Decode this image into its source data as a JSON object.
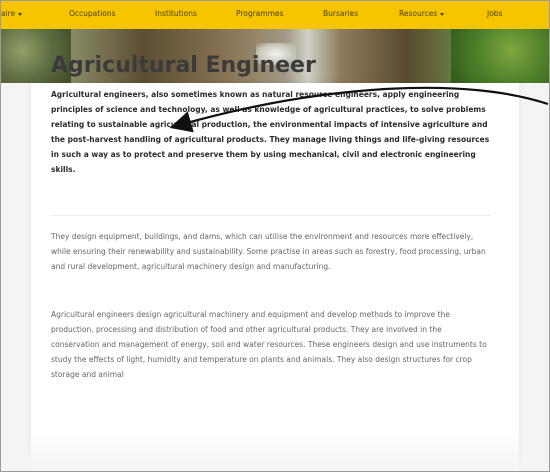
{
  "nav": {
    "items": [
      {
        "label": "aire",
        "dropdown": true
      },
      {
        "label": "Occupations",
        "dropdown": false
      },
      {
        "label": "Institutions",
        "dropdown": false
      },
      {
        "label": "Programmes",
        "dropdown": false
      },
      {
        "label": "Bursaries",
        "dropdown": false
      },
      {
        "label": "Resources",
        "dropdown": true
      },
      {
        "label": "Jobs",
        "dropdown": false
      }
    ],
    "bar_color": "#f6c500"
  },
  "hero": {
    "image": "waterfall-landscape-banner"
  },
  "page": {
    "title": "Agricultural Engineer",
    "lead": "Agricultural engineers, also sometimes known as natural resource engineers, apply engineering principles of science and technology, as well as knowledge of agricultural practices, to solve problems relating to sustainable agricultural production, the environmental impacts of intensive agriculture and the post-harvest handling of agricultural products. They manage living things and life-giving resources in such a way as to protect and preserve them by using mechanical, civil and electronic engineering skills.",
    "paragraphs": [
      "They design equipment, buildings, and dams, which can utilise the environment and resources more effectively, while ensuring their renewability and sustainability. Some practise in areas such as forestry, food processing, urban and rural development, agricultural machinery design and manufacturing.",
      "Agricultural engineers design agricultural machinery and equipment and develop methods to improve the production, processing and distribution of food and other agricultural products. They are involved in the conservation and management of energy, soil and water resources. These engineers design and use instruments to study the effects of light, humidity and temperature on plants and animals. They also design structures for crop storage and animal"
    ]
  },
  "annotation": {
    "icon": "curved-arrow-pointer",
    "color": "#111111"
  }
}
